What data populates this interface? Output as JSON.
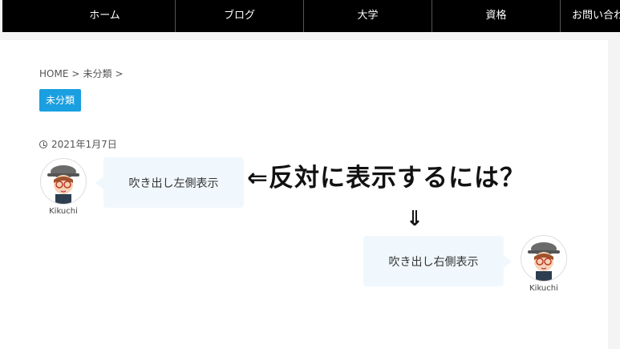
{
  "nav": {
    "items": [
      "ホーム",
      "ブログ",
      "大学",
      "資格",
      "お問い合わ"
    ]
  },
  "breadcrumb": {
    "home": "HOME",
    "sep1": ">",
    "category": "未分類",
    "sep2": ">"
  },
  "category_badge": "未分類",
  "post": {
    "date": "2021年1月7日"
  },
  "speech_left": {
    "text": "吹き出し左側表示",
    "author": "Kikuchi"
  },
  "speech_right": {
    "text": "吹き出し右側表示",
    "author": "Kikuchi"
  },
  "annotation": {
    "text": "⇐反対に表示するには？",
    "arrow": "⇓"
  },
  "colors": {
    "nav_bg": "#000000",
    "badge_bg": "#1a9fe0",
    "bubble_bg": "#f0f8fd"
  }
}
